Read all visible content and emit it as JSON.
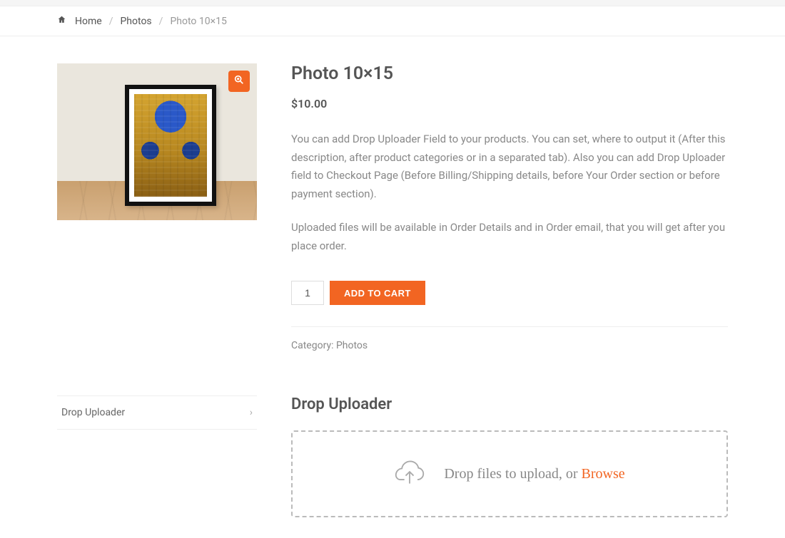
{
  "breadcrumbs": {
    "home": "Home",
    "photos": "Photos",
    "current": "Photo 10×15"
  },
  "product": {
    "title": "Photo 10×15",
    "price": "$10.00",
    "desc1": "You can add Drop Uploader Field to your products. You can set, where to output it (After this description, after product categories or in a separated tab). Also you can add Drop Uploader field to Checkout Page (Before Billing/Shipping details, before Your Order section or before payment section).",
    "desc2": "Uploaded files will be available in Order Details and in Order email, that you will get after you place order.",
    "quantity": "1",
    "add_to_cart": "ADD TO CART",
    "category_label": "Category: ",
    "category_value": "Photos"
  },
  "tabs": {
    "uploader_tab": "Drop Uploader",
    "uploader_title": "Drop Uploader",
    "drop_text": "Drop files to upload, or ",
    "browse": "Browse"
  }
}
